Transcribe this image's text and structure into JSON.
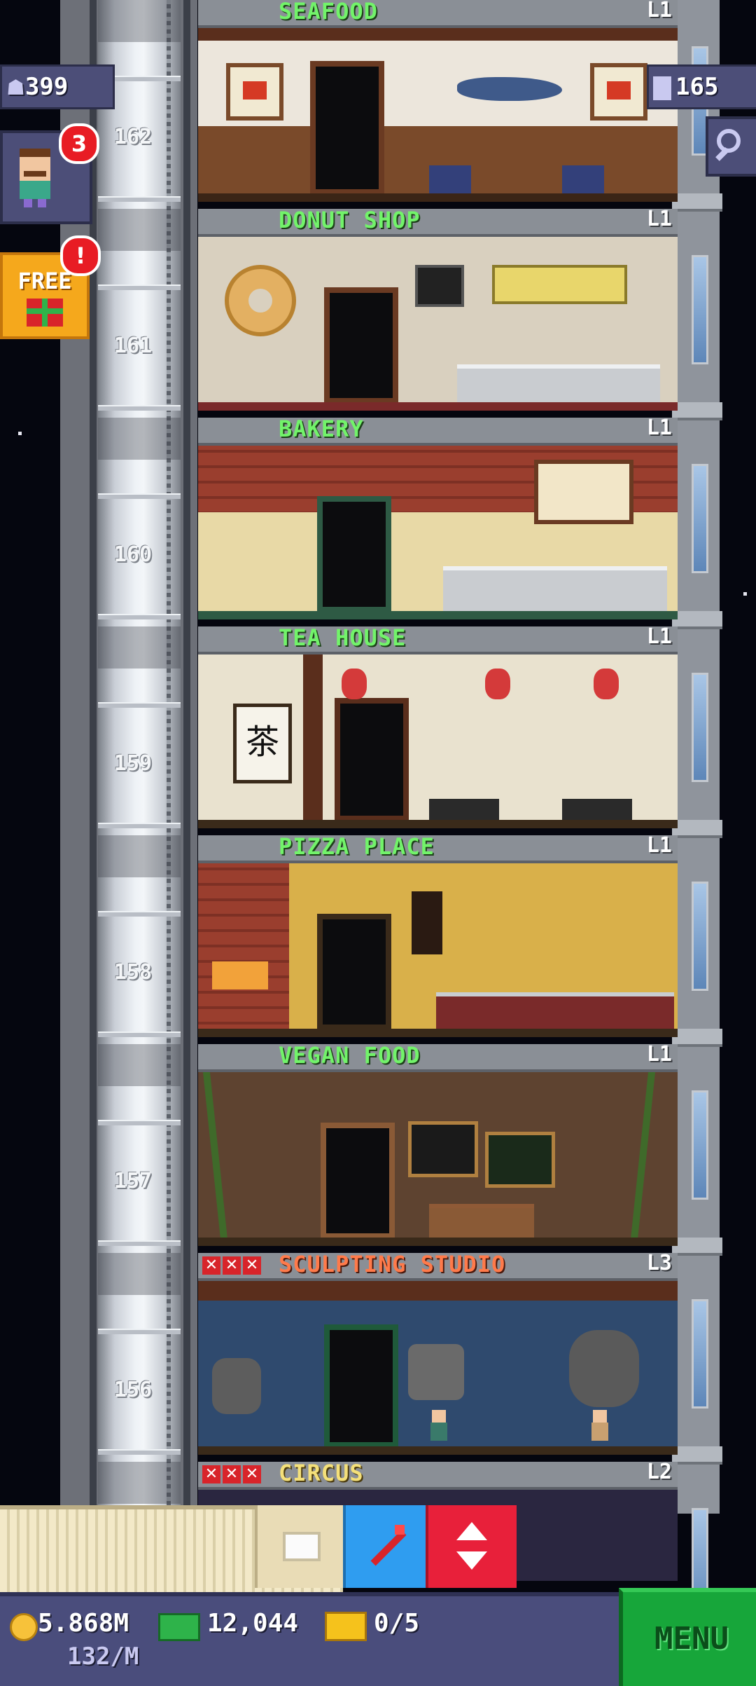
{
  "hud": {
    "population": "399",
    "floors_count": "165",
    "visitor_notifications": "3",
    "gift_label": "FREE",
    "gift_alert": "!"
  },
  "elevator": {
    "floor_numbers": [
      "162",
      "161",
      "160",
      "159",
      "158",
      "157",
      "156"
    ]
  },
  "floors": [
    {
      "name": "SEAFOOD",
      "level": "L1",
      "stock_marks": 0
    },
    {
      "name": "DONUT SHOP",
      "level": "L1",
      "stock_marks": 0
    },
    {
      "name": "BAKERY",
      "level": "L1",
      "stock_marks": 0
    },
    {
      "name": "TEA HOUSE",
      "level": "L1",
      "stock_marks": 0
    },
    {
      "name": "PIZZA PLACE",
      "level": "L1",
      "stock_marks": 0
    },
    {
      "name": "VEGAN FOOD",
      "level": "L1",
      "stock_marks": 0
    },
    {
      "name": "SCULPTING STUDIO",
      "level": "L3",
      "stock_marks": 3
    },
    {
      "name": "CIRCUS",
      "level": "L2",
      "stock_marks": 3
    }
  ],
  "tea_sign": "茶",
  "toolbar": {
    "buttons": [
      "box",
      "raffle",
      "elevator"
    ]
  },
  "status": {
    "coins": "5.868M",
    "coins_rate": "132/M",
    "bux": "12,044",
    "tickets": "0/5",
    "menu_label": "MENU"
  },
  "colors": {
    "floor_name_stocked": "#72f36a",
    "floor_name_unstocked": "#ff7a4a",
    "menu_green": "#17a63a",
    "bottom_bar": "#4a4d7c"
  }
}
